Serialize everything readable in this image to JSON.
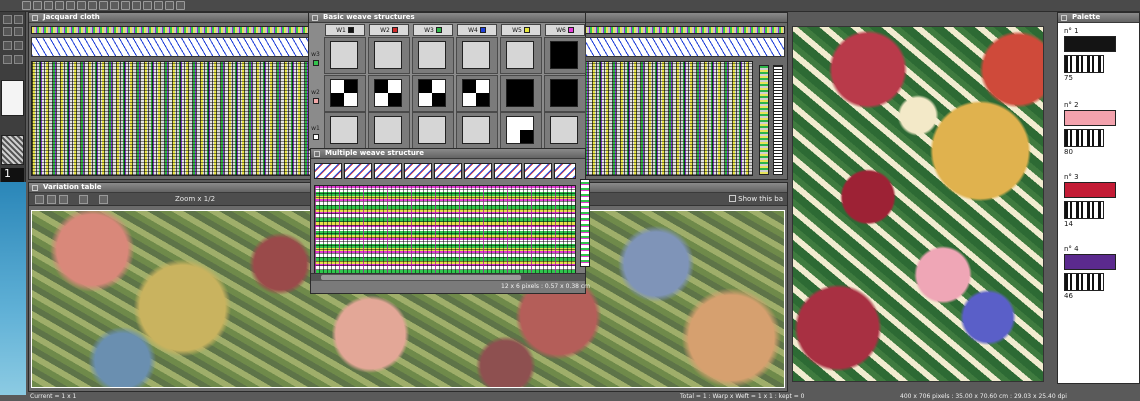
{
  "windows": {
    "jacquard": {
      "title": "Jacquard cloth"
    },
    "variation": {
      "title": "Variation table",
      "zoom": "Zoom x 1/2",
      "show_this_band": "Show this ba"
    },
    "basic_weave": {
      "title": "Basic weave structures",
      "columns": [
        {
          "label": "W1",
          "color": "#111111"
        },
        {
          "label": "W2",
          "color": "#d12a2a"
        },
        {
          "label": "W3",
          "color": "#2fb84a"
        },
        {
          "label": "W4",
          "color": "#1f3fd8"
        },
        {
          "label": "W5",
          "color": "#e6e63a"
        },
        {
          "label": "W6",
          "color": "#e33bd7"
        }
      ],
      "rows": [
        {
          "label": "w3",
          "color": "#33c44d"
        },
        {
          "label": "w2",
          "color": "#f2a8a8"
        },
        {
          "label": "w1",
          "color": "#ffffff"
        }
      ]
    },
    "multiple_weave": {
      "title": "Multiple weave structure",
      "status": "12 x 6 pixels : 0.57 x 0.38 cm"
    },
    "palette": {
      "title": "Palette",
      "entries": [
        {
          "label": "n° 1",
          "color": "#141414",
          "count": "75"
        },
        {
          "label": "n° 2",
          "color": "#f3a2ad",
          "count": "80"
        },
        {
          "label": "n° 3",
          "color": "#c41c36",
          "count": "14"
        },
        {
          "label": "n° 4",
          "color": "#5b2a8e",
          "count": "46"
        }
      ]
    }
  },
  "tools": {
    "layer_number": "1"
  },
  "status": {
    "current": "Current = 1 x 1",
    "total": "Total = 1 : Warp x Weft = 1 x 1 : kept = 0",
    "image_size": "400 x 706 pixels : 35.00 x 70.60 cm : 29.03 x 25.40 dpi"
  }
}
